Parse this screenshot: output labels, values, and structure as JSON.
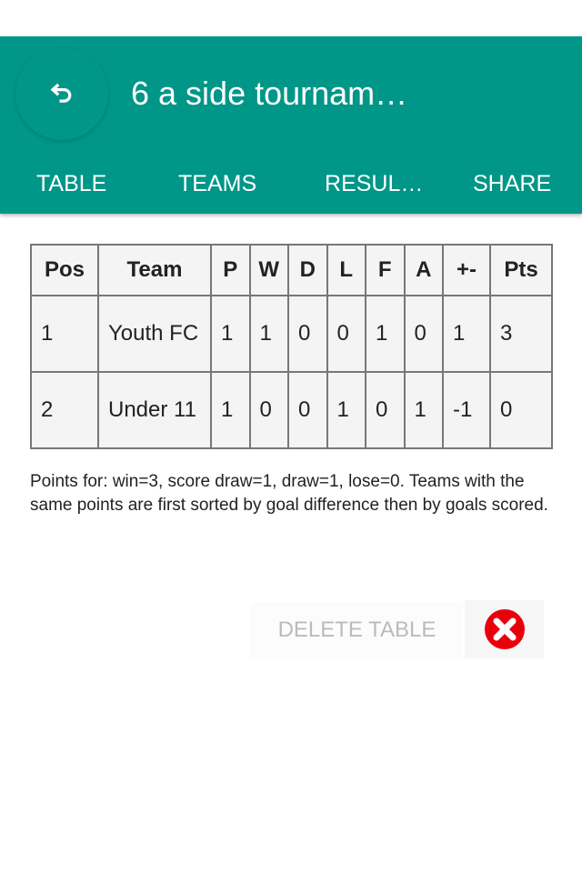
{
  "header": {
    "title": "6 a side tournam…",
    "back_icon": "undo-icon",
    "color": "#009688"
  },
  "tabs": [
    {
      "label": "TABLE"
    },
    {
      "label": "TEAMS"
    },
    {
      "label": "RESUL…"
    },
    {
      "label": "SHARE"
    }
  ],
  "table": {
    "headers": [
      "Pos",
      "Team",
      "P",
      "W",
      "D",
      "L",
      "F",
      "A",
      "+-",
      "Pts"
    ],
    "rows": [
      [
        "1",
        "Youth FC",
        "1",
        "1",
        "0",
        "0",
        "1",
        "0",
        "1",
        "3"
      ],
      [
        "2",
        "Under 11",
        "1",
        "0",
        "0",
        "1",
        "0",
        "1",
        "-1",
        "0"
      ]
    ]
  },
  "note": "Points for: win=3, score draw=1, draw=1, lose=0. Teams with the same points are first sorted by goal difference then by goals scored.",
  "delete": {
    "label": "DELETE TABLE",
    "icon": "close-circle-icon",
    "icon_color": "#e8000b"
  }
}
